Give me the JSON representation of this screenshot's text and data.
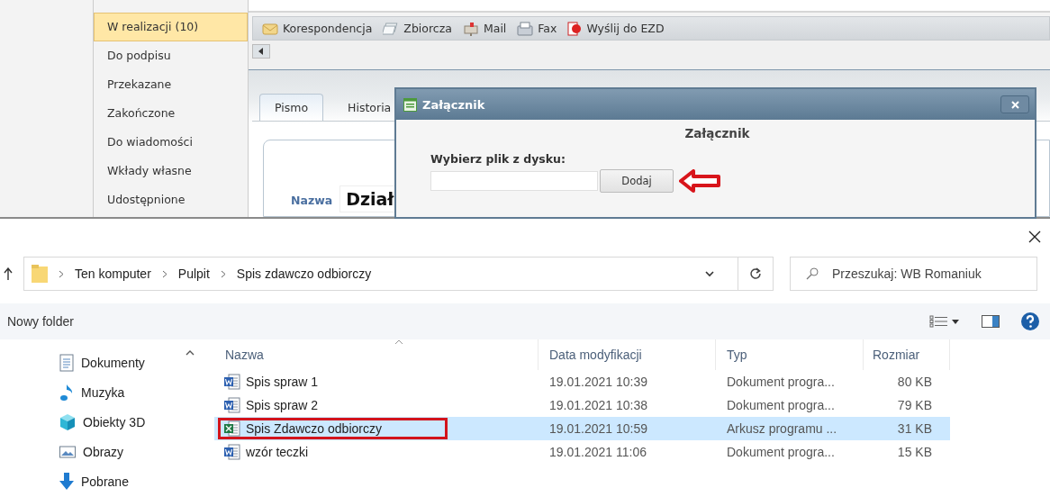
{
  "app": {
    "sidebar": {
      "items": [
        {
          "label": "W realizacji (10)",
          "selected": true
        },
        {
          "label": "Do podpisu",
          "selected": false
        },
        {
          "label": "Przekazane",
          "selected": false
        },
        {
          "label": "Zakończone",
          "selected": false
        },
        {
          "label": "Do wiadomości",
          "selected": false
        },
        {
          "label": "Wkłady własne",
          "selected": false
        },
        {
          "label": "Udostępnione",
          "selected": false
        }
      ]
    },
    "toolbar": [
      {
        "label": "Korespondencja",
        "kind": "envelope"
      },
      {
        "label": "Zbiorcza",
        "kind": "stack"
      },
      {
        "label": "Mail",
        "kind": "mailbox"
      },
      {
        "label": "Fax",
        "kind": "fax"
      },
      {
        "label": "Wyślij do EZD",
        "kind": "ezd"
      }
    ],
    "tabs": [
      {
        "label": "Pismo",
        "selected": true
      },
      {
        "label": "Historia",
        "selected": false
      }
    ],
    "form": {
      "name_label": "Nazwa",
      "name_value": "Dział"
    },
    "dialog": {
      "title": "Załącznik",
      "heading": "Załącznik",
      "file_label": "Wybierz plik z dysku:",
      "button": "Dodaj",
      "button_annotated": true
    }
  },
  "file_dialog": {
    "breadcrumbs": [
      "Ten komputer",
      "Pulpit",
      "Spis zdawczo odbiorczy"
    ],
    "search": {
      "placeholder": "Przeszukaj: WB Romaniuk"
    },
    "new_folder": "Nowy folder",
    "nav": [
      {
        "label": "Dokumenty",
        "kind": "documents"
      },
      {
        "label": "Muzyka",
        "kind": "music"
      },
      {
        "label": "Obiekty 3D",
        "kind": "cube"
      },
      {
        "label": "Obrazy",
        "kind": "pictures"
      },
      {
        "label": "Pobrane",
        "kind": "downloads"
      }
    ],
    "columns": [
      "Nazwa",
      "Data modyfikacji",
      "Typ",
      "Rozmiar"
    ],
    "rows": [
      {
        "name": "Spis spraw 1",
        "modified": "19.01.2021 10:39",
        "type": "Dokument progra...",
        "size": "80 KB",
        "kind": "word",
        "selected": false,
        "highlighted": false
      },
      {
        "name": "Spis spraw 2",
        "modified": "19.01.2021 10:38",
        "type": "Dokument progra...",
        "size": "79 KB",
        "kind": "word",
        "selected": false,
        "highlighted": false
      },
      {
        "name": "Spis Zdawczo odbiorczy",
        "modified": "19.01.2021 10:59",
        "type": "Arkusz programu ...",
        "size": "31 KB",
        "kind": "excel",
        "selected": true,
        "highlighted": true
      },
      {
        "name": "wzór teczki",
        "modified": "19.01.2021 11:06",
        "type": "Dokument progra...",
        "size": "15 KB",
        "kind": "word",
        "selected": false,
        "highlighted": false
      }
    ]
  }
}
